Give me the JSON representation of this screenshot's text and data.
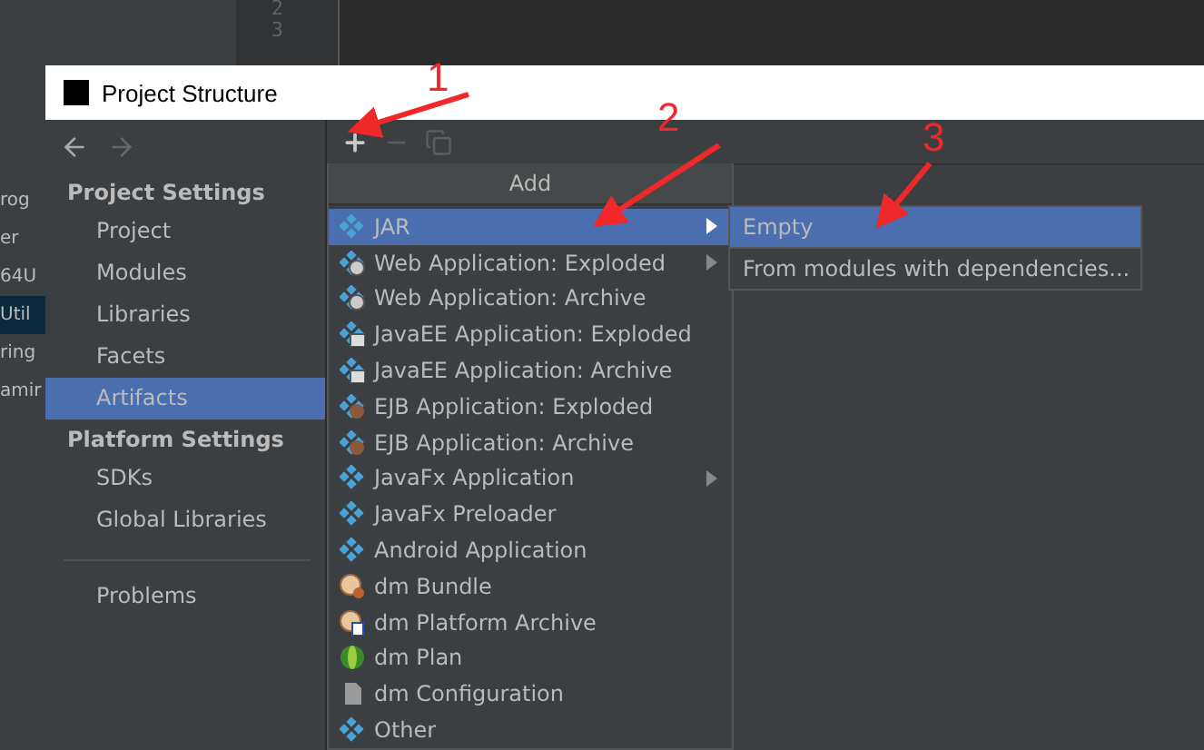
{
  "background": {
    "line_numbers": [
      "2",
      "3"
    ],
    "fragments": [
      {
        "text": "rog",
        "selected": false
      },
      {
        "text": "er",
        "selected": false
      },
      {
        "text": "64U",
        "selected": false
      },
      {
        "text": "Util",
        "selected": true
      },
      {
        "text": "ring",
        "selected": false
      },
      {
        "text": "amir",
        "selected": false
      }
    ]
  },
  "window": {
    "title": "Project Structure"
  },
  "sidebar": {
    "sections": [
      {
        "title": "Project Settings",
        "items": [
          {
            "label": "Project",
            "selected": false
          },
          {
            "label": "Modules",
            "selected": false
          },
          {
            "label": "Libraries",
            "selected": false
          },
          {
            "label": "Facets",
            "selected": false
          },
          {
            "label": "Artifacts",
            "selected": true
          }
        ]
      },
      {
        "title": "Platform Settings",
        "items": [
          {
            "label": "SDKs",
            "selected": false
          },
          {
            "label": "Global Libraries",
            "selected": false
          }
        ]
      },
      {
        "items": [
          {
            "label": "Problems",
            "selected": false
          }
        ]
      }
    ]
  },
  "toolbar": [
    {
      "kind": "add",
      "disabled": false
    },
    {
      "kind": "remove",
      "disabled": true
    },
    {
      "kind": "copy",
      "disabled": true
    }
  ],
  "popup": {
    "title": "Add",
    "items": [
      {
        "label": "JAR",
        "kind": "diamond",
        "selected": true,
        "submenu": true
      },
      {
        "label": "Web Application: Exploded",
        "kind": "web",
        "selected": false,
        "submenu": true
      },
      {
        "label": "Web Application: Archive",
        "kind": "web",
        "selected": false,
        "submenu": false
      },
      {
        "label": "JavaEE Application: Exploded",
        "kind": "javaee",
        "selected": false,
        "submenu": false
      },
      {
        "label": "JavaEE Application: Archive",
        "kind": "javaee",
        "selected": false,
        "submenu": false
      },
      {
        "label": "EJB Application: Exploded",
        "kind": "ejb",
        "selected": false,
        "submenu": false
      },
      {
        "label": "EJB Application: Archive",
        "kind": "ejb",
        "selected": false,
        "submenu": false
      },
      {
        "label": "JavaFx Application",
        "kind": "diamond",
        "selected": false,
        "submenu": true
      },
      {
        "label": "JavaFx Preloader",
        "kind": "diamond",
        "selected": false,
        "submenu": false
      },
      {
        "label": "Android Application",
        "kind": "diamond",
        "selected": false,
        "submenu": false
      },
      {
        "label": "dm Bundle",
        "kind": "bundle",
        "selected": false,
        "submenu": false
      },
      {
        "label": "dm Platform Archive",
        "kind": "platform",
        "selected": false,
        "submenu": false
      },
      {
        "label": "dm Plan",
        "kind": "plan",
        "selected": false,
        "submenu": false
      },
      {
        "label": "dm Configuration",
        "kind": "config",
        "selected": false,
        "submenu": false
      },
      {
        "label": "Other",
        "kind": "diamond",
        "selected": false,
        "submenu": false
      }
    ]
  },
  "submenu": {
    "items": [
      {
        "label": "Empty",
        "selected": true
      },
      {
        "label": "From modules with dependencies...",
        "selected": false
      }
    ]
  },
  "annotations": [
    {
      "label": "1"
    },
    {
      "label": "2"
    },
    {
      "label": "3"
    }
  ]
}
